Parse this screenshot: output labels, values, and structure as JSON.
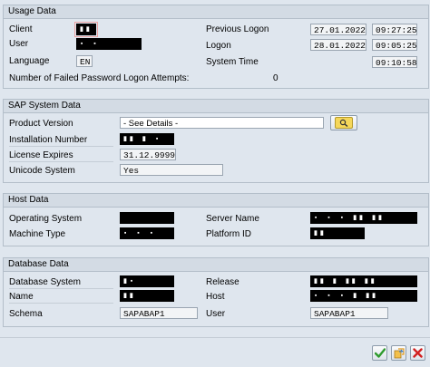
{
  "usage": {
    "title": "Usage Data",
    "client_label": "Client",
    "client_value": "▮▮",
    "user_label": "User",
    "user_value": "▪ ▪",
    "language_label": "Language",
    "language_value": "EN",
    "prev_logon_label": "Previous Logon",
    "prev_logon_date": "27.01.2022",
    "prev_logon_time": "09:27:25",
    "logon_label": "Logon",
    "logon_date": "28.01.2022",
    "logon_time": "09:05:25",
    "system_time_label": "System Time",
    "system_time_value": "09:10:58",
    "failed_label": "Number of Failed Password Logon Attempts:",
    "failed_value": "0"
  },
  "sap": {
    "title": "SAP System Data",
    "product_label": "Product Version",
    "product_value": "- See Details -",
    "install_label": "Installation Number",
    "install_value": "▮▮ ▮ ▪",
    "license_label": "License Expires",
    "license_value": "31.12.9999",
    "unicode_label": "Unicode System",
    "unicode_value": "Yes"
  },
  "host": {
    "title": "Host Data",
    "os_label": "Operating System",
    "os_value": "",
    "machine_label": "Machine Type",
    "machine_value": "▪ ▪ ▪",
    "server_label": "Server Name",
    "server_value": "▪ ▪ ▪ ▮▮ ▮▮",
    "platform_label": "Platform ID",
    "platform_value": "▮▮"
  },
  "db": {
    "title": "Database Data",
    "system_label": "Database System",
    "system_value": "▮▪",
    "name_label": "Name",
    "name_value": "▮▮",
    "schema_label": "Schema",
    "schema_value": "SAPABAP1",
    "release_label": "Release",
    "release_value": "▮▮ ▮ ▮▮ ▮▮",
    "host_label": "Host",
    "host_value": "▪ ▪ ▪ ▮ ▮▮",
    "user_label": "User",
    "user_value": "SAPABAP1"
  },
  "toolbar": {
    "accent_green": "#2e9b2e",
    "accent_orange": "#e39a1b",
    "accent_red": "#d22020"
  }
}
